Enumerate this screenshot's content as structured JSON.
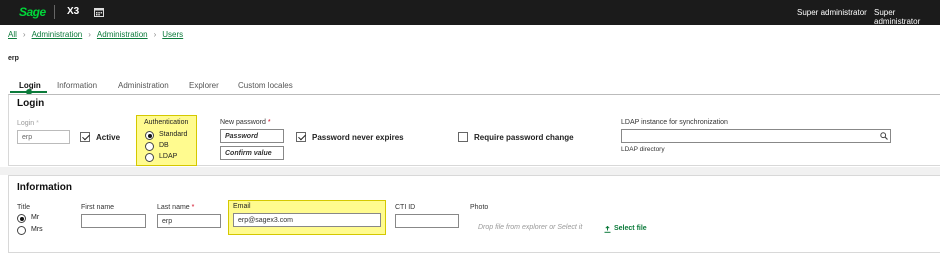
{
  "topbar": {
    "logo": "Sage",
    "product": "X3",
    "calendar_icon": "calendar-icon",
    "user_left": "Super administrator",
    "user_right": "Super administrator"
  },
  "breadcrumb": [
    "All",
    "Administration",
    "Administration",
    "Users"
  ],
  "record_title": "erp",
  "tabs": [
    "Login",
    "Information",
    "Administration",
    "Explorer",
    "Custom locales"
  ],
  "login_section": {
    "title": "Login",
    "login_label": "Login",
    "login_value": "erp",
    "active_label": "Active",
    "active_checked": true,
    "authentication_label": "Authentication",
    "authentication_options": [
      "Standard",
      "DB",
      "LDAP"
    ],
    "authentication_selected": "Standard",
    "new_password_label": "New password",
    "new_password_placeholder": "Password",
    "confirm_placeholder": "Confirm value",
    "never_expires_label": "Password never expires",
    "never_expires_checked": true,
    "require_change_label": "Require password change",
    "require_change_checked": false,
    "ldap_label": "LDAP instance for synchronization",
    "ldap_value": "",
    "ldap_directory_label": "LDAP directory"
  },
  "information_section": {
    "title": "Information",
    "title_label": "Title",
    "title_options": [
      "Mr",
      "Mrs"
    ],
    "title_selected": "Mr",
    "first_name_label": "First name",
    "first_name_value": "",
    "last_name_label": "Last name",
    "last_name_value": "erp",
    "email_label": "Email",
    "email_value": "erp@sagex3.com",
    "cti_label": "CTI ID",
    "cti_value": "",
    "photo_label": "Photo",
    "dropzone_text": "Drop file from explorer or Select it",
    "select_file_label": "Select file"
  },
  "colors": {
    "accent": "#0b7a3a",
    "highlight": "#fffb8f",
    "topbar": "#1b1b1b"
  }
}
